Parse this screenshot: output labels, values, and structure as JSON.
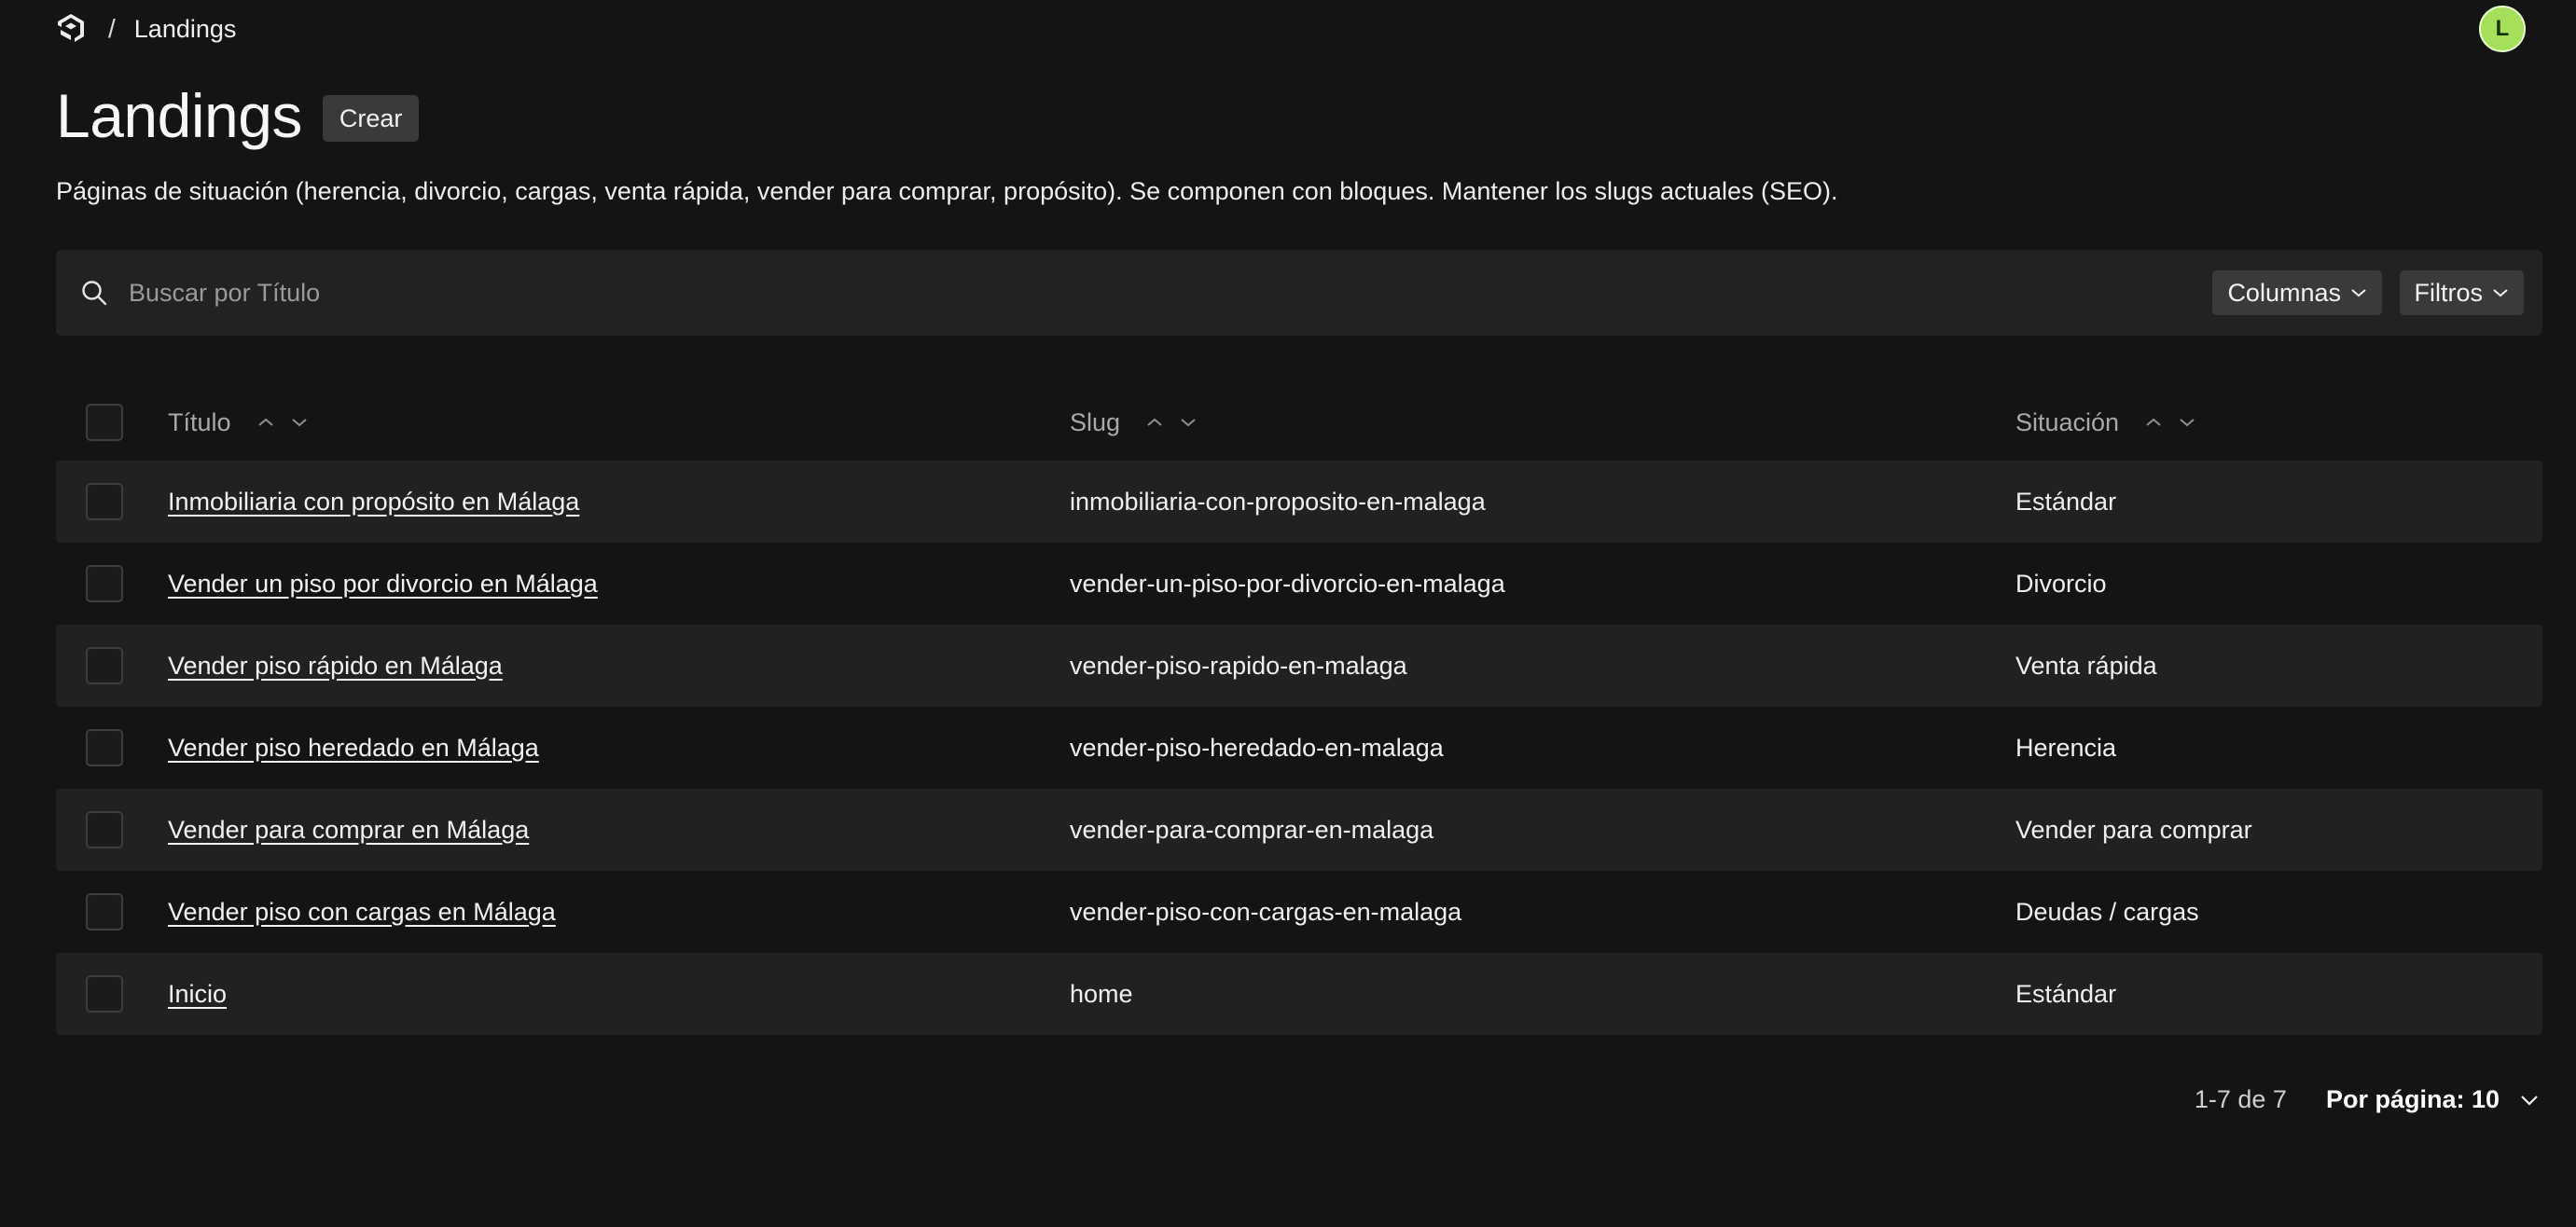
{
  "breadcrumb": {
    "separator": "/",
    "current": "Landings"
  },
  "user": {
    "avatar_initial": "L"
  },
  "header": {
    "title": "Landings",
    "create_label": "Crear",
    "description": "Páginas de situación (herencia, divorcio, cargas, venta rápida, vender para comprar, propósito). Se componen con bloques. Mantener los slugs actuales (SEO)."
  },
  "search": {
    "placeholder": "Buscar por Título",
    "value": ""
  },
  "toolbar": {
    "columns_label": "Columnas",
    "filters_label": "Filtros"
  },
  "table": {
    "columns": [
      "Título",
      "Slug",
      "Situación"
    ],
    "rows": [
      {
        "title": "Inmobiliaria con propósito en Málaga",
        "slug": "inmobiliaria-con-proposito-en-malaga",
        "situation": "Estándar"
      },
      {
        "title": "Vender un piso por divorcio en Málaga",
        "slug": "vender-un-piso-por-divorcio-en-malaga",
        "situation": "Divorcio"
      },
      {
        "title": "Vender piso rápido en Málaga",
        "slug": "vender-piso-rapido-en-malaga",
        "situation": "Venta rápida"
      },
      {
        "title": "Vender piso heredado en Málaga",
        "slug": "vender-piso-heredado-en-malaga",
        "situation": "Herencia"
      },
      {
        "title": "Vender para comprar en Málaga",
        "slug": "vender-para-comprar-en-malaga",
        "situation": "Vender para comprar"
      },
      {
        "title": "Vender piso con cargas en Málaga",
        "slug": "vender-piso-con-cargas-en-malaga",
        "situation": "Deudas / cargas"
      },
      {
        "title": "Inicio",
        "slug": "home",
        "situation": "Estándar"
      }
    ]
  },
  "pagination": {
    "range": "1-7 de 7",
    "per_page_label": "Por página: 10"
  },
  "icons": {
    "logo": "payload-logo-icon",
    "search": "search-icon",
    "dropdown": "chevron-down-icon",
    "sort_asc": "chevron-up-icon",
    "sort_desc": "chevron-down-icon"
  },
  "colors": {
    "background": "#141414",
    "row_alt": "#212121",
    "accent_avatar": "#a6e05a"
  }
}
